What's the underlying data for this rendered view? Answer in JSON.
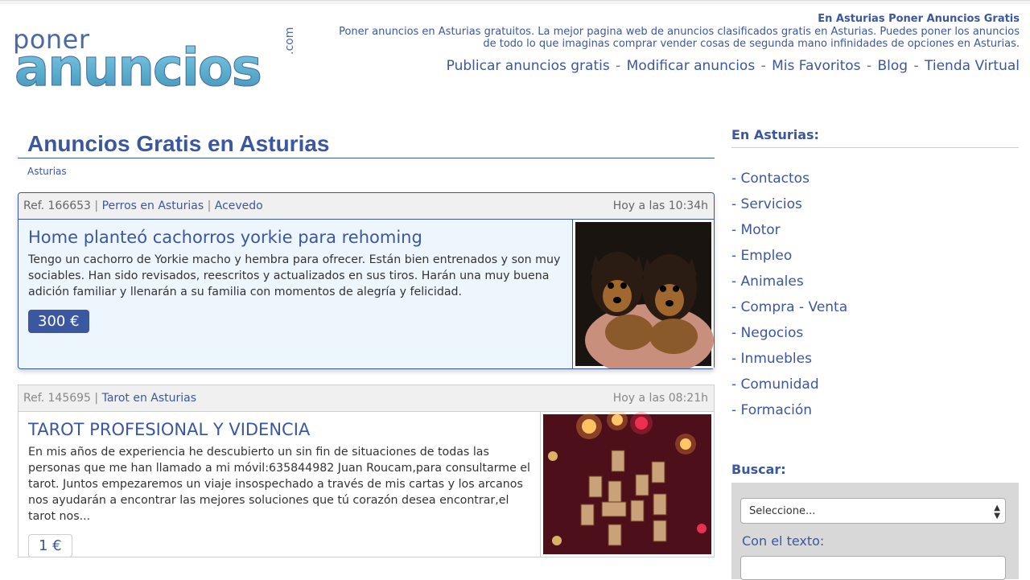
{
  "logo": {
    "small": "poner",
    "big": "anuncios",
    "tld": ".com"
  },
  "header": {
    "title": "En Asturias Poner Anuncios Gratis",
    "description_line1": "Poner anuncios en Asturias gratuitos. La mejor pagina web de anuncios clasificados gratis en Asturias. Puedes poner los anuncios",
    "description_line2": "de todo lo que imaginas comprar vender cosas de segunda mano infinidades de opciones en Asturias.",
    "nav": [
      {
        "label": "Publicar anuncios gratis"
      },
      {
        "label": "Modificar anuncios"
      },
      {
        "label": "Mis Favoritos"
      },
      {
        "label": "Blog"
      },
      {
        "label": "Tienda Virtual"
      }
    ],
    "nav_separator": "-"
  },
  "main": {
    "title": "Anuncios Gratis en Asturias",
    "breadcrumb": "Asturias",
    "ads": [
      {
        "ref": "Ref. 166653",
        "category": "Perros en Asturias",
        "location": "Acevedo",
        "time": "Hoy a las 10:34h",
        "title": "Home planteó cachorros yorkie para rehoming",
        "description": "Tengo un cachorro de Yorkie macho y hembra para ofrecer. Están bien entrenados y son muy sociables. Han sido revisados, reescritos y actualizados en sus tiros. Harán una muy buena adición familiar y llenarán a su familia con momentos de alegría y felicidad.",
        "price": "300 €"
      },
      {
        "ref": "Ref. 145695",
        "category": "Tarot en Asturias",
        "time": "Hoy a las 08:21h",
        "title": "TAROT PROFESIONAL Y VIDENCIA",
        "description": "En mis años de experiencia he descubierto un sin fin de situaciones de todas las personas que me han llamado a mi móvil:635844982 Juan Roucam,para consultarme el tarot. Juntos empezaremos un viaje insospechado a través de mis cartas y los arcanos nos ayudarán a encontrar las mejores soluciones que tú corazón desea encontrar,el tarot nos...",
        "price": "1 €"
      }
    ]
  },
  "sidebar": {
    "heading": "En Asturias:",
    "categories": [
      {
        "label": "- Contactos"
      },
      {
        "label": "- Servicios"
      },
      {
        "label": "- Motor"
      },
      {
        "label": "- Empleo"
      },
      {
        "label": "- Animales"
      },
      {
        "label": "- Compra - Venta"
      },
      {
        "label": "- Negocios"
      },
      {
        "label": "- Inmuebles"
      },
      {
        "label": "- Comunidad"
      },
      {
        "label": "- Formación"
      }
    ],
    "search": {
      "heading": "Buscar:",
      "select_value": "Seleccione...",
      "text_label": "Con el texto:"
    }
  },
  "colors": {
    "brand": "#3a57a0",
    "logo_teal": "#5fb2d0",
    "featured_bg": "#eef6fd"
  }
}
